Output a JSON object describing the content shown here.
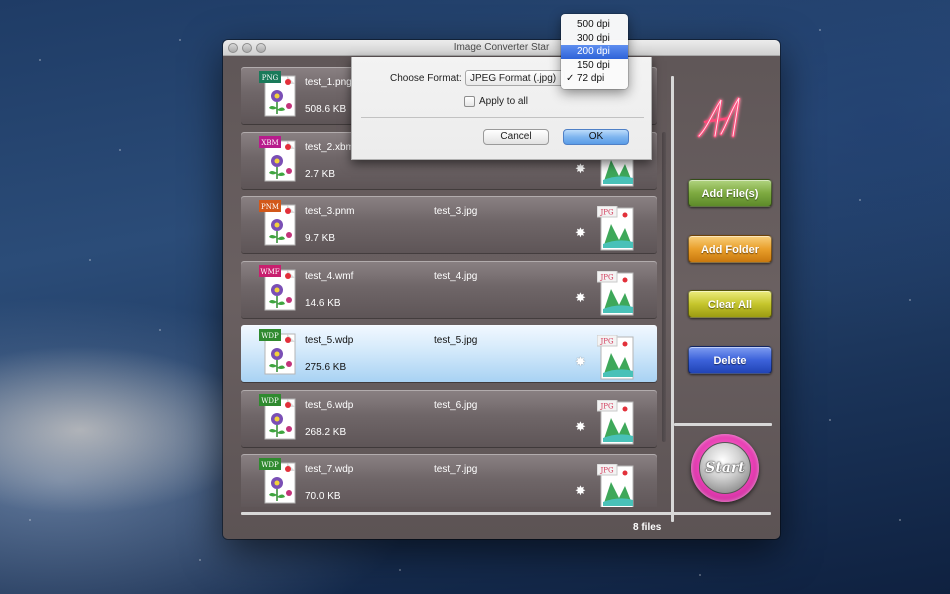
{
  "window": {
    "title": "Image Converter Star"
  },
  "files": [
    {
      "name": "test_1.png",
      "size": "508.6 KB",
      "output": "",
      "badge": "PNG",
      "badge_color": "#1a7a5a"
    },
    {
      "name": "test_2.xbm",
      "size": "2.7 KB",
      "output": "",
      "badge": "XBM",
      "badge_color": "#b71c8c"
    },
    {
      "name": "test_3.pnm",
      "size": "9.7 KB",
      "output": "test_3.jpg",
      "badge": "PNM",
      "badge_color": "#d2581a"
    },
    {
      "name": "test_4.wmf",
      "size": "14.6 KB",
      "output": "test_4.jpg",
      "badge": "WMF",
      "badge_color": "#c81f6e"
    },
    {
      "name": "test_5.wdp",
      "size": "275.6 KB",
      "output": "test_5.jpg",
      "badge": "WDP",
      "badge_color": "#2f8a2f"
    },
    {
      "name": "test_6.wdp",
      "size": "268.2 KB",
      "output": "test_6.jpg",
      "badge": "WDP",
      "badge_color": "#2f8a2f"
    },
    {
      "name": "test_7.wdp",
      "size": "70.0 KB",
      "output": "test_7.jpg",
      "badge": "WDP",
      "badge_color": "#2f8a2f"
    }
  ],
  "selected_row": 4,
  "output_badge": "JPG",
  "file_count": "8 files",
  "sidebar": {
    "add_files": "Add File(s)",
    "add_folder": "Add Folder",
    "clear_all": "Clear All",
    "delete": "Delete",
    "start": "Start"
  },
  "dialog": {
    "format_label": "Choose Format:",
    "format_value": "JPEG Format (.jpg)",
    "apply_label": "Apply to all",
    "apply_checked": false,
    "cancel": "Cancel",
    "ok": "OK"
  },
  "dpi_menu": {
    "options": [
      "500 dpi",
      "300 dpi",
      "200 dpi",
      "150 dpi",
      "72 dpi"
    ],
    "highlighted": "200 dpi",
    "checked": "72 dpi"
  },
  "colors": {
    "selection": "#a8d2f3",
    "add_files": "#7eaa41",
    "add_folder": "#e99f2b",
    "clear_all": "#c5c52c",
    "delete": "#3c62da",
    "start_ring": "#e83fb4",
    "ok_button": "#7fb5ef"
  }
}
